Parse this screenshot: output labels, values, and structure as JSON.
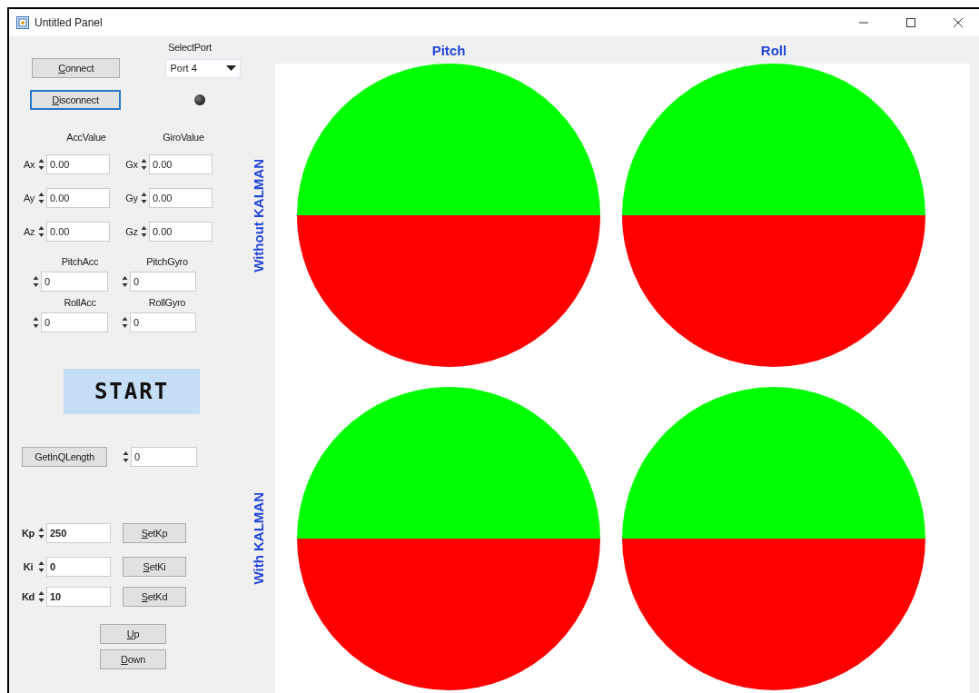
{
  "window": {
    "title": "Untitled Panel"
  },
  "connection": {
    "port_label": "SelectPort",
    "port_value": "Port 4",
    "indicator_on": false,
    "buttons": [
      {
        "label": "Connect",
        "focused": false,
        "underline_first": true
      },
      {
        "label": "Disconnect",
        "focused": true,
        "underline_first": true
      }
    ]
  },
  "acc_header": "AccValue",
  "gyro_header": "GiroValue",
  "sensor_rows": [
    {
      "acc_label": "Ax",
      "acc_value": "0.00",
      "gyro_label": "Gx",
      "gyro_value": "0.00"
    },
    {
      "acc_label": "Ay",
      "acc_value": "0.00",
      "gyro_label": "Gy",
      "gyro_value": "0.00"
    },
    {
      "acc_label": "Az",
      "acc_value": "0.00",
      "gyro_label": "Gz",
      "gyro_value": "0.00"
    }
  ],
  "angle_rows": [
    [
      {
        "label": "PitchAcc",
        "value": "0"
      },
      {
        "label": "PitchGyro",
        "value": "0"
      }
    ],
    [
      {
        "label": "RollAcc",
        "value": "0"
      },
      {
        "label": "RollGyro",
        "value": "0"
      }
    ]
  ],
  "start_button": "START",
  "queue": {
    "button": "GetInQLength",
    "value": "0"
  },
  "gains": [
    {
      "label": "Kp",
      "value": "250",
      "button": "SetKp"
    },
    {
      "label": "Ki",
      "value": "0",
      "button": "SetKi"
    },
    {
      "label": "Kd",
      "value": "10",
      "button": "SetKd"
    }
  ],
  "jog_buttons": [
    {
      "label": "Up",
      "underline_first": true
    },
    {
      "label": "Down",
      "underline_first": true
    }
  ],
  "gauge_columns": [
    "Pitch",
    "Roll"
  ],
  "gauge_rows": [
    {
      "label": "Without KALMAN",
      "gauges": [
        {
          "kind": "horizon"
        },
        {
          "kind": "horizon"
        }
      ]
    },
    {
      "label": "With KALMAN",
      "gauges": [
        {
          "kind": "horizon"
        },
        {
          "kind": "horizon"
        }
      ]
    }
  ]
}
